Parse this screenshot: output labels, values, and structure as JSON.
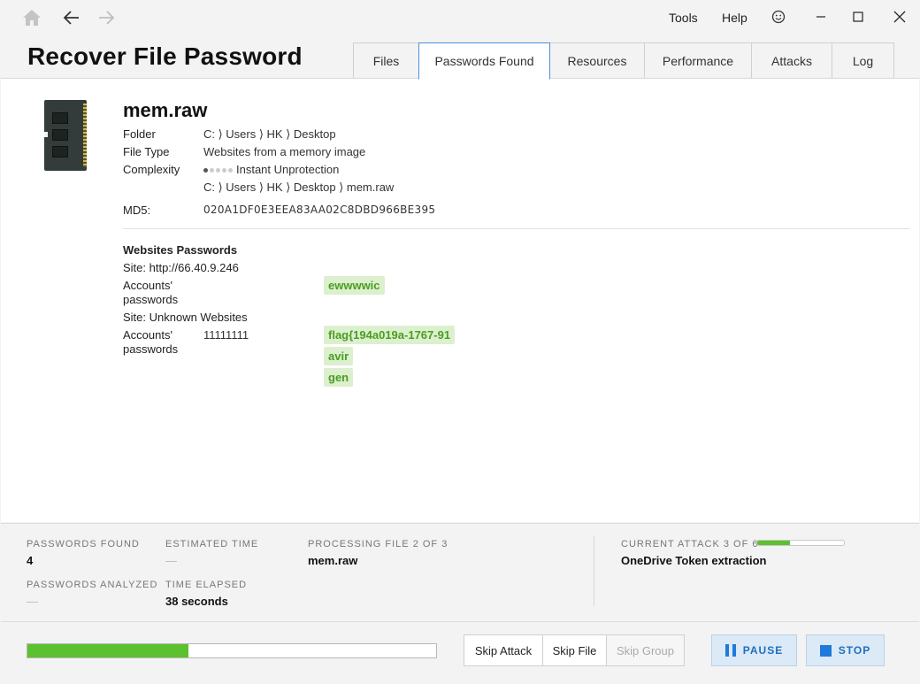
{
  "app": {
    "title": "Recover File Password"
  },
  "menu": {
    "tools": "Tools",
    "help": "Help"
  },
  "tabs": [
    "Files",
    "Passwords Found",
    "Resources",
    "Performance",
    "Attacks",
    "Log"
  ],
  "file": {
    "name": "mem.raw",
    "folder_label": "Folder",
    "folder_value": "C: ⟩ Users ⟩ HK ⟩ Desktop",
    "type_label": "File Type",
    "type_value": "Websites from a memory image",
    "complexity_label": "Complexity",
    "complexity_value": "Instant Unprotection",
    "complexity_level": 1,
    "path_value": "C: ⟩ Users ⟩ HK ⟩ Desktop ⟩ mem.raw",
    "md5_label": "MD5:",
    "md5_value": "020A1DF0E3EEA83AA02C8DBD966BE395"
  },
  "websites": {
    "heading": "Websites Passwords",
    "site1": "Site: http://66.40.9.246",
    "accounts_label_1": "Accounts'",
    "accounts_label_2": "passwords",
    "site1_password": "ewwwwic",
    "site2": "Site: Unknown Websites",
    "site2_account": "11111111",
    "site2_passwords": [
      "flag{194a019a-1767-91",
      "avir",
      "gen"
    ]
  },
  "status": {
    "passwords_found_label": "PASSWORDS FOUND",
    "passwords_found_value": "4",
    "estimated_time_label": "ESTIMATED TIME",
    "estimated_time_value": "—",
    "processing_label": "PROCESSING FILE 2 OF 3",
    "processing_value": "mem.raw",
    "current_attack_label": "CURRENT ATTACK 3 OF 6",
    "current_attack_value": "OneDrive Token extraction",
    "current_attack_progress": 0.38,
    "passwords_analyzed_label": "PASSWORDS ANALYZED",
    "passwords_analyzed_value": "—",
    "time_elapsed_label": "TIME ELAPSED",
    "time_elapsed_value": "38 seconds"
  },
  "controls": {
    "overall_progress": 0.395,
    "skip_attack": "Skip Attack",
    "skip_file": "Skip File",
    "skip_group": "Skip Group",
    "pause": "PAUSE",
    "stop": "STOP"
  }
}
